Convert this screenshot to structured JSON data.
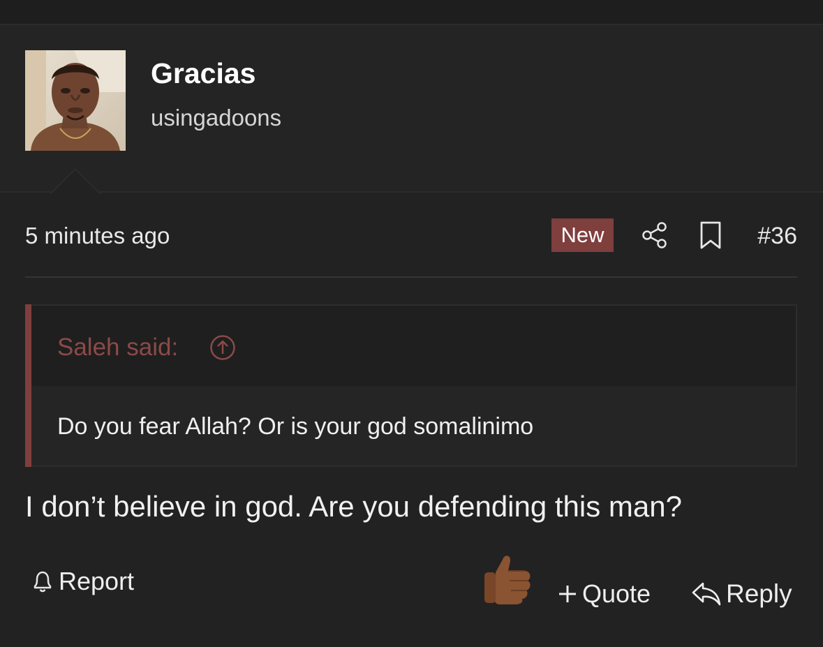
{
  "post": {
    "author": {
      "username": "Gracias",
      "title": "usingadoons",
      "avatar_icon": "avatar-photo"
    },
    "timestamp": "5 minutes ago",
    "badge": "New",
    "post_number": "#36",
    "quote": {
      "attribution": "Saleh said:",
      "text": "Do you fear Allah? Or is your god somalinimo"
    },
    "body": "I don’t believe in god. Are you defending this man?",
    "actions": {
      "report_label": "Report",
      "quote_label": "Quote",
      "reply_label": "Reply"
    },
    "reaction_icon": "thumbs-up-emoji"
  },
  "colors": {
    "background": "#222222",
    "accent": "#7f3f3d",
    "quote_attribution": "#8b4a48",
    "text": "#ececec"
  }
}
